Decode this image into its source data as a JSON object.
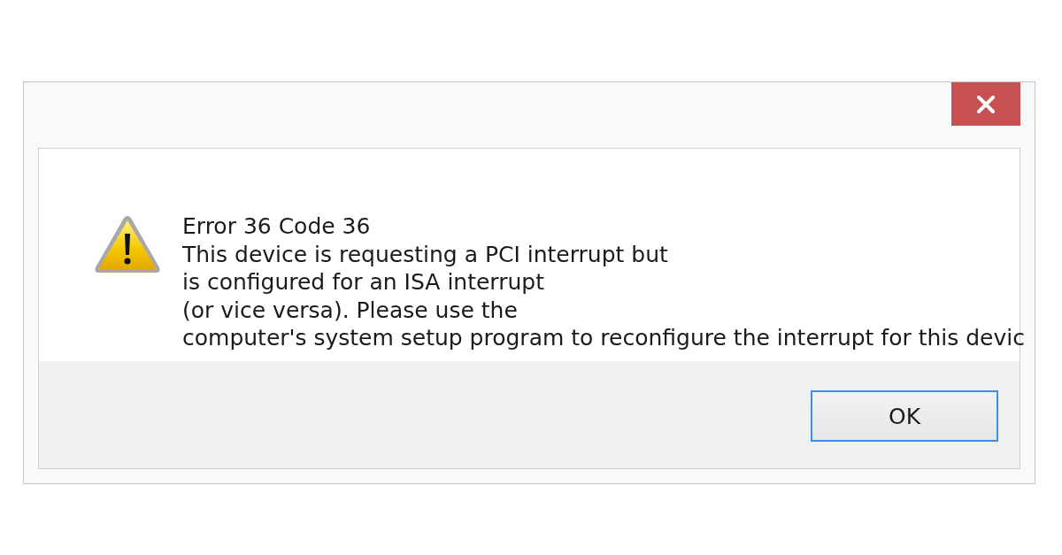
{
  "dialog": {
    "heading": "Error 36 Code 36",
    "message_lines": [
      "This device is requesting a PCI interrupt but",
      "is configured for an ISA interrupt",
      "(or vice versa). Please use the",
      "computer's system setup program to reconfigure the interrupt for this devic"
    ],
    "buttons": [
      {
        "label": "OK",
        "focused": true
      }
    ]
  }
}
